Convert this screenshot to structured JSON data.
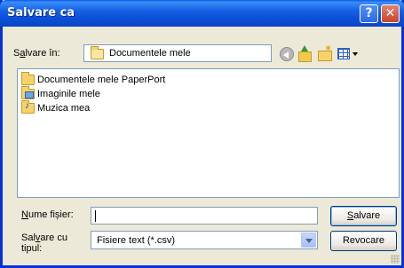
{
  "window": {
    "title": "Salvare ca"
  },
  "titlebar_buttons": {
    "help": "?",
    "close": "✕"
  },
  "save_in": {
    "label_prefix": "S",
    "label_u": "a",
    "label_rest": "lvare în:",
    "value": "Documentele mele"
  },
  "toolbar": {
    "back_icon": "back-arrow-icon",
    "up_icon": "up-folder-icon",
    "new_folder_icon": "new-folder-icon",
    "views_icon": "views-menu-icon"
  },
  "files": [
    {
      "name": "Documentele mele PaperPort",
      "icon": "folder-icon"
    },
    {
      "name": "Imaginile mele",
      "icon": "pictures-folder-icon"
    },
    {
      "name": "Muzica mea",
      "icon": "music-folder-icon"
    }
  ],
  "filename": {
    "label_u": "N",
    "label_rest": "ume fișier:",
    "value": ""
  },
  "filetype": {
    "label_line1_a": "Sal",
    "label_line1_u": "v",
    "label_line1_b": "are cu",
    "label_line2": "tipul:",
    "value": "Fisiere text (*.csv)"
  },
  "buttons": {
    "save_u": "S",
    "save_rest": "alvare",
    "cancel": "Revocare"
  }
}
